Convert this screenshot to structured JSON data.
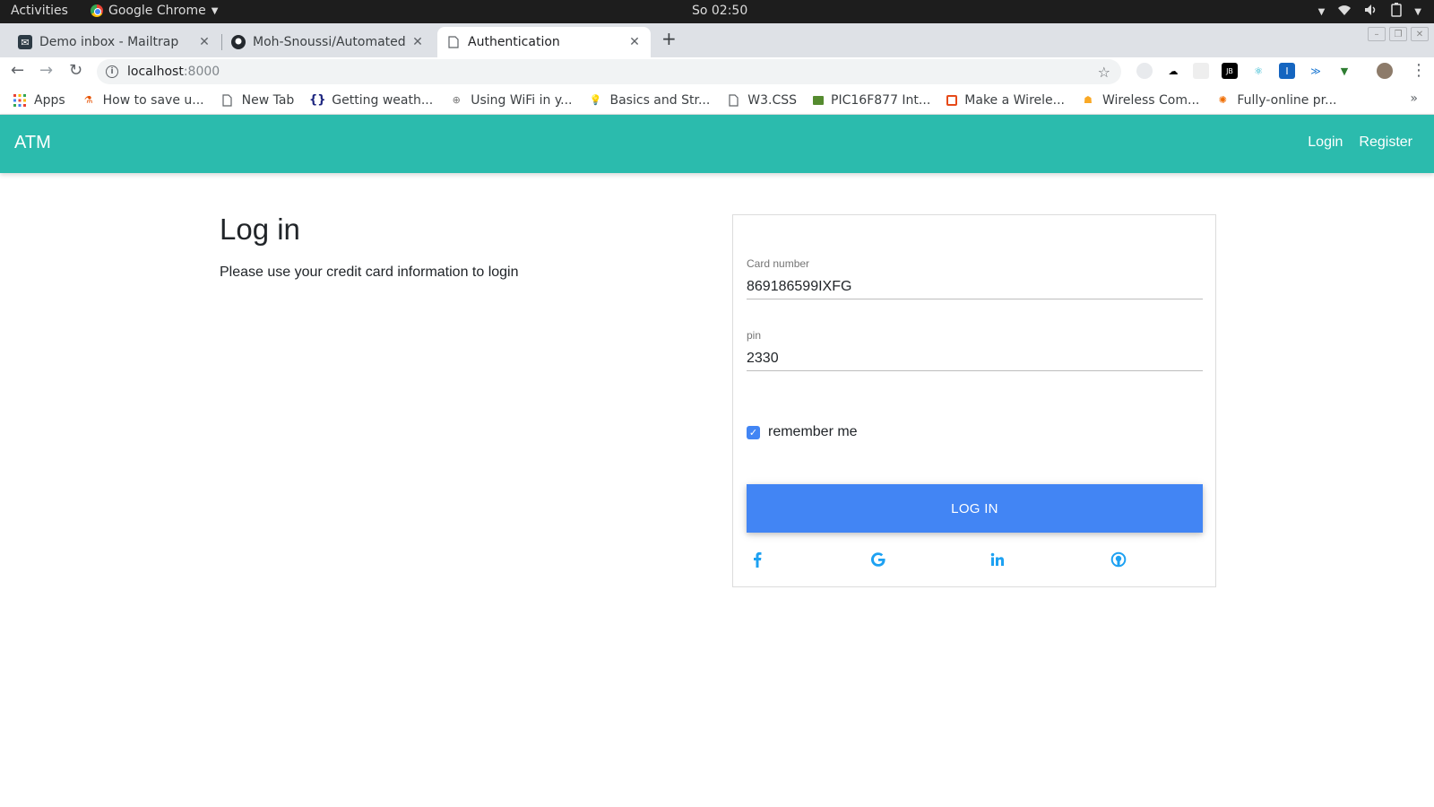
{
  "os_bar": {
    "activities": "Activities",
    "app_name": "Google Chrome",
    "clock": "So 02:50"
  },
  "tabs": [
    {
      "title": "Demo inbox - Mailtrap",
      "icon": "mailtrap-icon"
    },
    {
      "title": "Moh-Snoussi/Automated",
      "icon": "github-icon"
    },
    {
      "title": "Authentication",
      "icon": "page-icon",
      "active": true
    }
  ],
  "address_bar": {
    "host": "localhost",
    "port": ":8000"
  },
  "bookmarks": [
    {
      "label": "Apps",
      "icon": "apps-grid-icon"
    },
    {
      "label": "How to save u...",
      "icon": "bookmark-icon"
    },
    {
      "label": "New Tab",
      "icon": "page-icon"
    },
    {
      "label": "Getting weath...",
      "icon": "braces-icon"
    },
    {
      "label": "Using WiFi in y...",
      "icon": "globe-icon"
    },
    {
      "label": "Basics and Str...",
      "icon": "bulb-icon"
    },
    {
      "label": "W3.CSS",
      "icon": "page-icon"
    },
    {
      "label": "PIC16F877 Int...",
      "icon": "chip-icon"
    },
    {
      "label": "Make a Wirele...",
      "icon": "circuit-icon"
    },
    {
      "label": "Wireless Com...",
      "icon": "robot-icon"
    },
    {
      "label": "Fully-online pr...",
      "icon": "swirl-icon"
    }
  ],
  "app": {
    "brand": "ATM",
    "nav_login": "Login",
    "nav_register": "Register",
    "accent_color": "#2bbbad"
  },
  "intro": {
    "heading": "Log in",
    "description": "Please use your credit card information to login"
  },
  "form": {
    "card_label": "Card number",
    "card_value": "869186599IXFG",
    "pin_label": "pin",
    "pin_value": "2330",
    "remember_label": "remember me",
    "remember_checked": true,
    "submit_label": "LOG IN",
    "button_color": "#4285f4"
  },
  "social": [
    "facebook-icon",
    "google-icon",
    "linkedin-icon",
    "github-icon"
  ]
}
